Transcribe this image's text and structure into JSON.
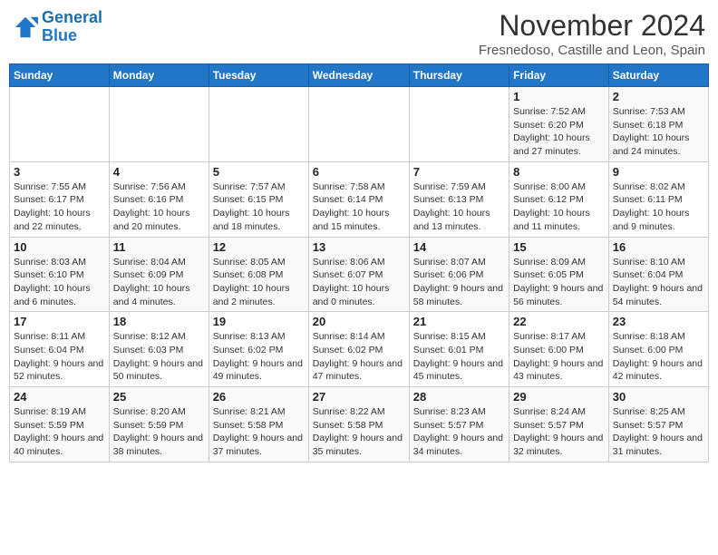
{
  "header": {
    "logo_line1": "General",
    "logo_line2": "Blue",
    "title": "November 2024",
    "subtitle": "Fresnedoso, Castille and Leon, Spain"
  },
  "weekdays": [
    "Sunday",
    "Monday",
    "Tuesday",
    "Wednesday",
    "Thursday",
    "Friday",
    "Saturday"
  ],
  "weeks": [
    [
      {
        "day": "",
        "info": ""
      },
      {
        "day": "",
        "info": ""
      },
      {
        "day": "",
        "info": ""
      },
      {
        "day": "",
        "info": ""
      },
      {
        "day": "",
        "info": ""
      },
      {
        "day": "1",
        "info": "Sunrise: 7:52 AM\nSunset: 6:20 PM\nDaylight: 10 hours and 27 minutes."
      },
      {
        "day": "2",
        "info": "Sunrise: 7:53 AM\nSunset: 6:18 PM\nDaylight: 10 hours and 24 minutes."
      }
    ],
    [
      {
        "day": "3",
        "info": "Sunrise: 7:55 AM\nSunset: 6:17 PM\nDaylight: 10 hours and 22 minutes."
      },
      {
        "day": "4",
        "info": "Sunrise: 7:56 AM\nSunset: 6:16 PM\nDaylight: 10 hours and 20 minutes."
      },
      {
        "day": "5",
        "info": "Sunrise: 7:57 AM\nSunset: 6:15 PM\nDaylight: 10 hours and 18 minutes."
      },
      {
        "day": "6",
        "info": "Sunrise: 7:58 AM\nSunset: 6:14 PM\nDaylight: 10 hours and 15 minutes."
      },
      {
        "day": "7",
        "info": "Sunrise: 7:59 AM\nSunset: 6:13 PM\nDaylight: 10 hours and 13 minutes."
      },
      {
        "day": "8",
        "info": "Sunrise: 8:00 AM\nSunset: 6:12 PM\nDaylight: 10 hours and 11 minutes."
      },
      {
        "day": "9",
        "info": "Sunrise: 8:02 AM\nSunset: 6:11 PM\nDaylight: 10 hours and 9 minutes."
      }
    ],
    [
      {
        "day": "10",
        "info": "Sunrise: 8:03 AM\nSunset: 6:10 PM\nDaylight: 10 hours and 6 minutes."
      },
      {
        "day": "11",
        "info": "Sunrise: 8:04 AM\nSunset: 6:09 PM\nDaylight: 10 hours and 4 minutes."
      },
      {
        "day": "12",
        "info": "Sunrise: 8:05 AM\nSunset: 6:08 PM\nDaylight: 10 hours and 2 minutes."
      },
      {
        "day": "13",
        "info": "Sunrise: 8:06 AM\nSunset: 6:07 PM\nDaylight: 10 hours and 0 minutes."
      },
      {
        "day": "14",
        "info": "Sunrise: 8:07 AM\nSunset: 6:06 PM\nDaylight: 9 hours and 58 minutes."
      },
      {
        "day": "15",
        "info": "Sunrise: 8:09 AM\nSunset: 6:05 PM\nDaylight: 9 hours and 56 minutes."
      },
      {
        "day": "16",
        "info": "Sunrise: 8:10 AM\nSunset: 6:04 PM\nDaylight: 9 hours and 54 minutes."
      }
    ],
    [
      {
        "day": "17",
        "info": "Sunrise: 8:11 AM\nSunset: 6:04 PM\nDaylight: 9 hours and 52 minutes."
      },
      {
        "day": "18",
        "info": "Sunrise: 8:12 AM\nSunset: 6:03 PM\nDaylight: 9 hours and 50 minutes."
      },
      {
        "day": "19",
        "info": "Sunrise: 8:13 AM\nSunset: 6:02 PM\nDaylight: 9 hours and 49 minutes."
      },
      {
        "day": "20",
        "info": "Sunrise: 8:14 AM\nSunset: 6:02 PM\nDaylight: 9 hours and 47 minutes."
      },
      {
        "day": "21",
        "info": "Sunrise: 8:15 AM\nSunset: 6:01 PM\nDaylight: 9 hours and 45 minutes."
      },
      {
        "day": "22",
        "info": "Sunrise: 8:17 AM\nSunset: 6:00 PM\nDaylight: 9 hours and 43 minutes."
      },
      {
        "day": "23",
        "info": "Sunrise: 8:18 AM\nSunset: 6:00 PM\nDaylight: 9 hours and 42 minutes."
      }
    ],
    [
      {
        "day": "24",
        "info": "Sunrise: 8:19 AM\nSunset: 5:59 PM\nDaylight: 9 hours and 40 minutes."
      },
      {
        "day": "25",
        "info": "Sunrise: 8:20 AM\nSunset: 5:59 PM\nDaylight: 9 hours and 38 minutes."
      },
      {
        "day": "26",
        "info": "Sunrise: 8:21 AM\nSunset: 5:58 PM\nDaylight: 9 hours and 37 minutes."
      },
      {
        "day": "27",
        "info": "Sunrise: 8:22 AM\nSunset: 5:58 PM\nDaylight: 9 hours and 35 minutes."
      },
      {
        "day": "28",
        "info": "Sunrise: 8:23 AM\nSunset: 5:57 PM\nDaylight: 9 hours and 34 minutes."
      },
      {
        "day": "29",
        "info": "Sunrise: 8:24 AM\nSunset: 5:57 PM\nDaylight: 9 hours and 32 minutes."
      },
      {
        "day": "30",
        "info": "Sunrise: 8:25 AM\nSunset: 5:57 PM\nDaylight: 9 hours and 31 minutes."
      }
    ]
  ]
}
